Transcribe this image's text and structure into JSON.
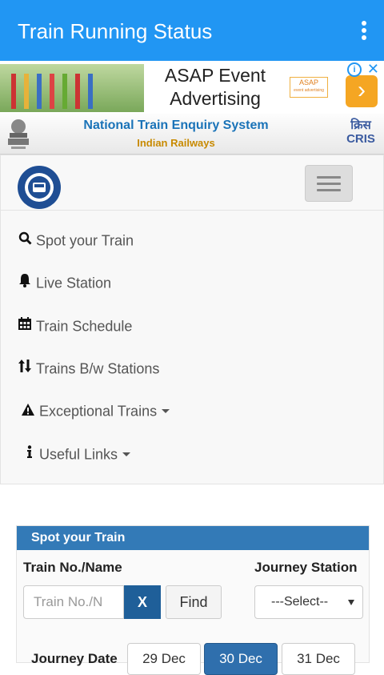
{
  "appbar": {
    "title": "Train Running Status",
    "menu_icon": "more-vert-icon"
  },
  "ad": {
    "text_line1": "ASAP Event",
    "text_line2": "Advertising",
    "logo_text": "ASAP",
    "logo_sub": "event advertising",
    "go_icon": "chevron-right-icon",
    "info_icon": "info-icon",
    "close_icon": "close-icon"
  },
  "banner": {
    "title": "National Train Enquiry System",
    "subtitle": "Indian Railways",
    "cris_hindi": "क्रिस",
    "cris": "CRIS",
    "colors": {
      "title": "#1a73b8",
      "subtitle": "#c88a00"
    }
  },
  "nav": {
    "brand_icon": "ntes-logo-icon",
    "toggle_icon": "hamburger-icon",
    "items": [
      {
        "label": "Spot your Train",
        "icon": "search-icon"
      },
      {
        "label": "Live Station",
        "icon": "bell-icon"
      },
      {
        "label": "Train Schedule",
        "icon": "calendar-icon"
      },
      {
        "label": "Trains B/w Stations",
        "icon": "sort-arrows-icon"
      },
      {
        "label": "Exceptional Trains",
        "icon": "warning-icon"
      },
      {
        "label": "Useful Links",
        "icon": "info-icon"
      }
    ]
  },
  "panel": {
    "title": "Spot your Train",
    "train_label": "Train No./Name",
    "station_label": "Journey Station",
    "train_placeholder": "Train No./N",
    "clear_label": "X",
    "find_label": "Find",
    "station_selected": "---Select--",
    "date_label": "Journey Date",
    "dates": [
      "29 Dec",
      "30 Dec",
      "31 Dec"
    ],
    "active_date": "30 Dec",
    "accent_color": "#337ab7"
  }
}
